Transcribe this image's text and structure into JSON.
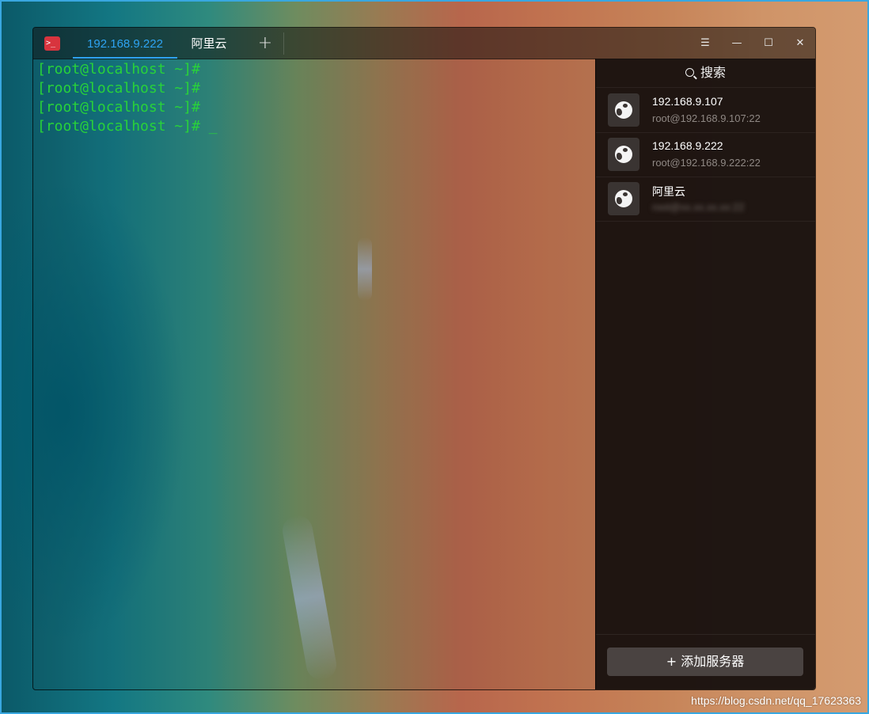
{
  "titlebar": {
    "app_icon": "terminal-app-icon",
    "app_icon_glyph": ">_",
    "tabs": [
      {
        "label": "192.168.9.222",
        "active": true
      },
      {
        "label": "阿里云",
        "active": false
      }
    ],
    "add_tab_glyph": "+",
    "controls": {
      "menu": "☰",
      "minimize": "—",
      "maximize": "☐",
      "close": "✕"
    }
  },
  "terminal": {
    "lines": [
      "[root@localhost ~]#",
      "[root@localhost ~]#",
      "[root@localhost ~]#",
      "[root@localhost ~]# "
    ],
    "cursor": "_",
    "text_color": "#28d23a"
  },
  "panel": {
    "search_label": "搜索",
    "servers": [
      {
        "name": "192.168.9.107",
        "address": "root@192.168.9.107:22",
        "icon": "globe-icon"
      },
      {
        "name": "192.168.9.222",
        "address": "root@192.168.9.222:22",
        "icon": "globe-icon"
      },
      {
        "name": "阿里云",
        "address": "root@xx.xx.xx.xx:22",
        "icon": "globe-icon",
        "address_blurred": true
      }
    ],
    "add_server_label": "+ 添加服务器"
  },
  "watermark": "https://blog.csdn.net/qq_17623363",
  "colors": {
    "accent": "#2ea3f2",
    "screenshot_border": "#39a7e0",
    "app_icon_bg": "#d8343e"
  }
}
